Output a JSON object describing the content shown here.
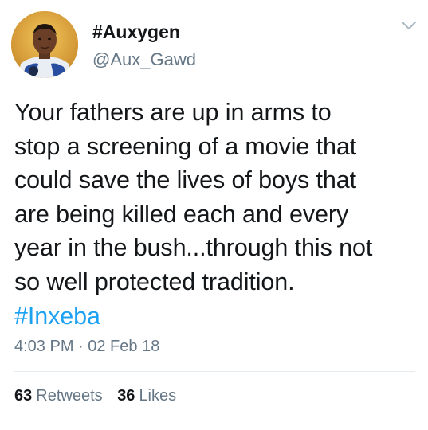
{
  "user": {
    "display_name": "#Auxygen",
    "handle": "@Aux_Gawd"
  },
  "tweet": {
    "lines": [
      "Your fathers are up in arms to",
      "stop a screening of a movie that",
      "could save the lives of boys that",
      "are being killed each and every",
      "year in the bush...through this not",
      "so well protected tradition."
    ],
    "hashtag": "#Inxeba",
    "timestamp": "4:03 PM · 02 Feb 18"
  },
  "stats": {
    "retweets_count": "63",
    "retweets_label": "Retweets",
    "likes_count": "36",
    "likes_label": "Likes"
  },
  "icons": {
    "menu": "chevron-down-icon"
  },
  "colors": {
    "link": "#1da1f2",
    "secondary_text": "#657786",
    "primary_text": "#14171a",
    "divider": "#e6ecf0"
  }
}
